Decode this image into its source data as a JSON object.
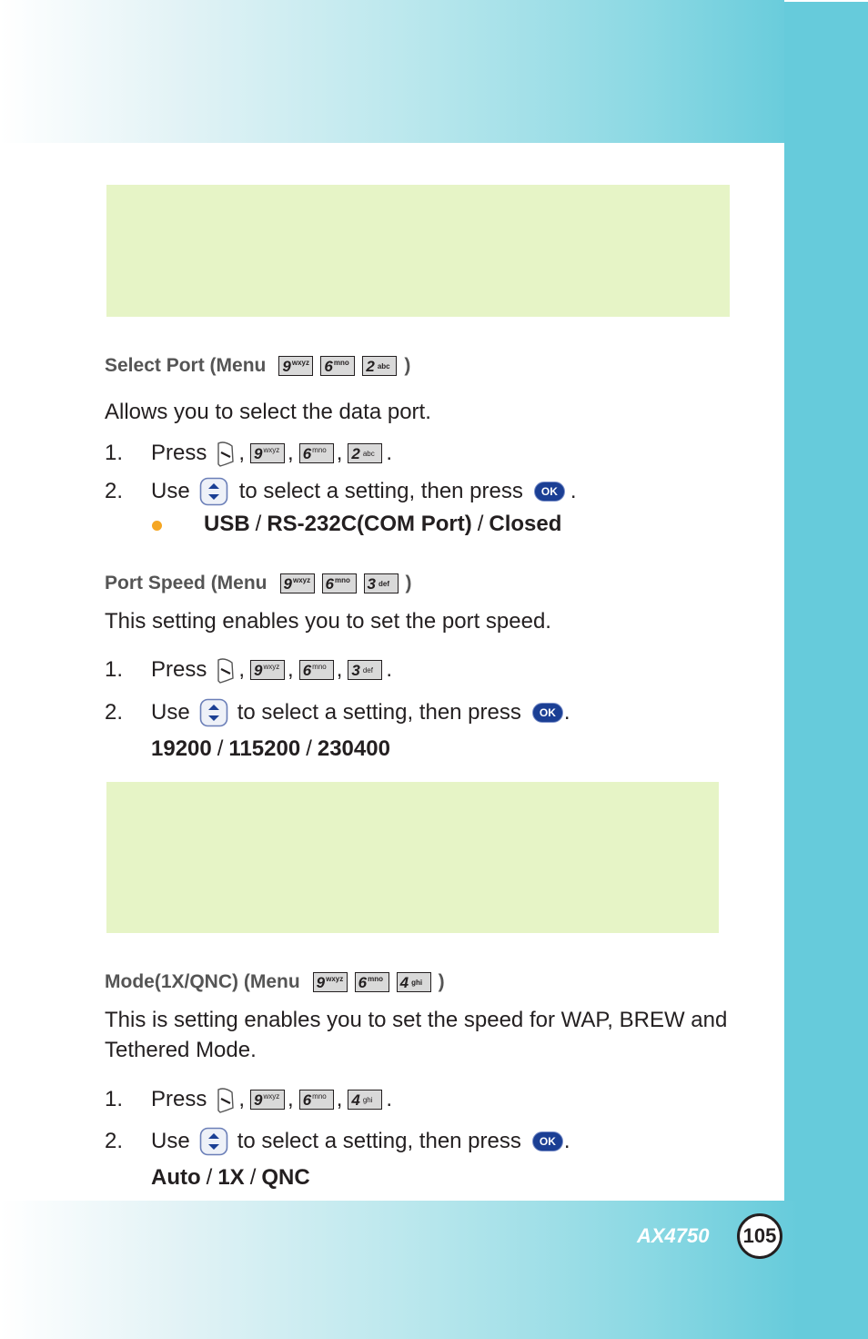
{
  "colors": {
    "accent_teal": "#66cbdb",
    "note_box": "#e6f4c6",
    "heading_gray": "#555555",
    "bullet_orange": "#f5a623",
    "ok_button_blue": "#1b3f94"
  },
  "sections": [
    {
      "heading": "Select Port (Menu",
      "menu_keys": [
        {
          "digit": "9",
          "letters": "wxyz"
        },
        {
          "digit": "6",
          "letters": "mno"
        },
        {
          "digit": "2",
          "letters": "abc"
        }
      ],
      "heading_close": ")",
      "description": "Allows you to select the data port.",
      "steps": [
        {
          "num": "1.",
          "word": "Press",
          "icon": "send-key-icon",
          "keys": [
            {
              "digit": "9",
              "letters": "wxyz"
            },
            {
              "digit": "6",
              "letters": "mno"
            },
            {
              "digit": "2",
              "letters": "abc"
            }
          ],
          "end": "."
        },
        {
          "num": "2.",
          "word": "Use",
          "icon": "navigation-key-icon",
          "text": "to select a setting, then press",
          "button": "OK",
          "end": "."
        }
      ],
      "options": [
        "USB",
        "RS-232C(COM Port)",
        "Closed"
      ],
      "options_bulleted": true
    },
    {
      "heading": "Port Speed (Menu",
      "menu_keys": [
        {
          "digit": "9",
          "letters": "wxyz"
        },
        {
          "digit": "6",
          "letters": "mno"
        },
        {
          "digit": "3",
          "letters": "def"
        }
      ],
      "heading_close": ")",
      "description": "This setting enables you to set the port speed.",
      "steps": [
        {
          "num": "1.",
          "word": "Press",
          "icon": "send-key-icon",
          "keys": [
            {
              "digit": "9",
              "letters": "wxyz"
            },
            {
              "digit": "6",
              "letters": "mno"
            },
            {
              "digit": "3",
              "letters": "def"
            }
          ],
          "end": "."
        },
        {
          "num": "2.",
          "word": "Use",
          "icon": "navigation-key-icon",
          "text": "to select a setting, then press",
          "button": "OK",
          "end": "."
        }
      ],
      "options": [
        "19200",
        "115200",
        "230400"
      ],
      "options_bulleted": false
    },
    {
      "heading": "Mode(1X/QNC) (Menu",
      "menu_keys": [
        {
          "digit": "9",
          "letters": "wxyz"
        },
        {
          "digit": "6",
          "letters": "mno"
        },
        {
          "digit": "4",
          "letters": "ghi"
        }
      ],
      "heading_close": ")",
      "description": "This is setting enables you to set the speed for WAP, BREW and Tethered Mode.",
      "steps": [
        {
          "num": "1.",
          "word": "Press",
          "icon": "send-key-icon",
          "keys": [
            {
              "digit": "9",
              "letters": "wxyz"
            },
            {
              "digit": "6",
              "letters": "mno"
            },
            {
              "digit": "4",
              "letters": "ghi"
            }
          ],
          "end": "."
        },
        {
          "num": "2.",
          "word": "Use",
          "icon": "navigation-key-icon",
          "text": "to select a setting, then press",
          "button": "OK",
          "end": "."
        }
      ],
      "options": [
        "Auto",
        "1X",
        "QNC"
      ],
      "options_bulleted": false
    }
  ],
  "footer": {
    "model": "AX4750",
    "page_number": "105"
  },
  "punct": {
    "comma": ",",
    "slash": "/"
  }
}
